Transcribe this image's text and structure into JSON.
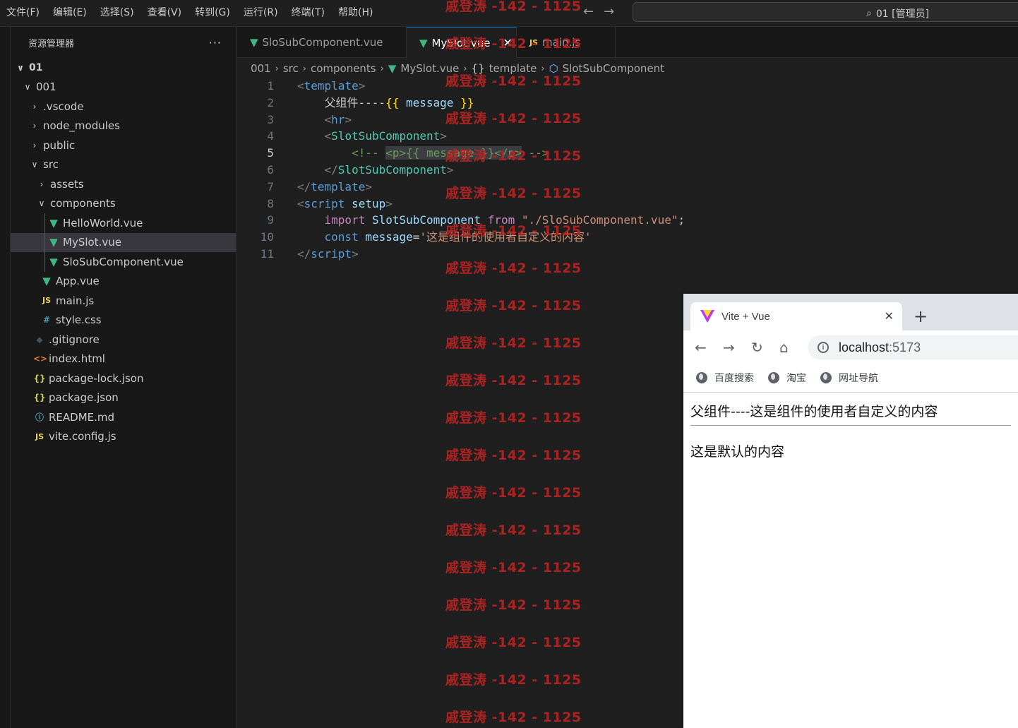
{
  "menu": [
    "文件(F)",
    "编辑(E)",
    "选择(S)",
    "查看(V)",
    "转到(G)",
    "运行(R)",
    "终端(T)",
    "帮助(H)"
  ],
  "command_center": {
    "text": "01 [管理员]"
  },
  "explorer": {
    "title": "资源管理器",
    "more": "···",
    "items": [
      {
        "label": "01",
        "depth": 0,
        "type": "folder-open"
      },
      {
        "label": "001",
        "depth": 1,
        "type": "folder-open"
      },
      {
        "label": ".vscode",
        "depth": 2,
        "type": "folder"
      },
      {
        "label": "node_modules",
        "depth": 2,
        "type": "folder"
      },
      {
        "label": "public",
        "depth": 2,
        "type": "folder"
      },
      {
        "label": "src",
        "depth": 2,
        "type": "folder-open"
      },
      {
        "label": "assets",
        "depth": 3,
        "type": "folder"
      },
      {
        "label": "components",
        "depth": 3,
        "type": "folder-open"
      },
      {
        "label": "HelloWorld.vue",
        "depth": 4,
        "type": "vue"
      },
      {
        "label": "MySlot.vue",
        "depth": 4,
        "type": "vue",
        "selected": true
      },
      {
        "label": "SloSubComponent.vue",
        "depth": 4,
        "type": "vue"
      },
      {
        "label": "App.vue",
        "depth": 3,
        "type": "vue"
      },
      {
        "label": "main.js",
        "depth": 3,
        "type": "js"
      },
      {
        "label": "style.css",
        "depth": 3,
        "type": "css"
      },
      {
        "label": ".gitignore",
        "depth": 2,
        "type": "git"
      },
      {
        "label": "index.html",
        "depth": 2,
        "type": "html"
      },
      {
        "label": "package-lock.json",
        "depth": 2,
        "type": "json"
      },
      {
        "label": "package.json",
        "depth": 2,
        "type": "json"
      },
      {
        "label": "README.md",
        "depth": 2,
        "type": "info"
      },
      {
        "label": "vite.config.js",
        "depth": 2,
        "type": "js"
      }
    ]
  },
  "tabs": [
    {
      "label": "SloSubComponent.vue",
      "icon": "vue"
    },
    {
      "label": "MySlot.vue",
      "icon": "vue",
      "active": true
    },
    {
      "label": "main.js",
      "icon": "js"
    }
  ],
  "breadcrumb": [
    "001",
    "src",
    "components",
    "MySlot.vue",
    "template",
    "SlotSubComponent"
  ],
  "code": {
    "current_line": 5,
    "line_numbers": [
      "1",
      "2",
      "3",
      "4",
      "5",
      "6",
      "7",
      "8",
      "9",
      "10",
      "11"
    ]
  },
  "watermark": "戚登涛 -142 - 1125",
  "browser": {
    "tab_title": "Vite + Vue",
    "url_host": "localhost",
    "url_port": ":5173",
    "bookmarks": [
      "百度搜索",
      "淘宝",
      "网址导航"
    ],
    "page_line1": "父组件----这是组件的使用者自定义的内容",
    "page_line2": "这是默认的内容"
  }
}
